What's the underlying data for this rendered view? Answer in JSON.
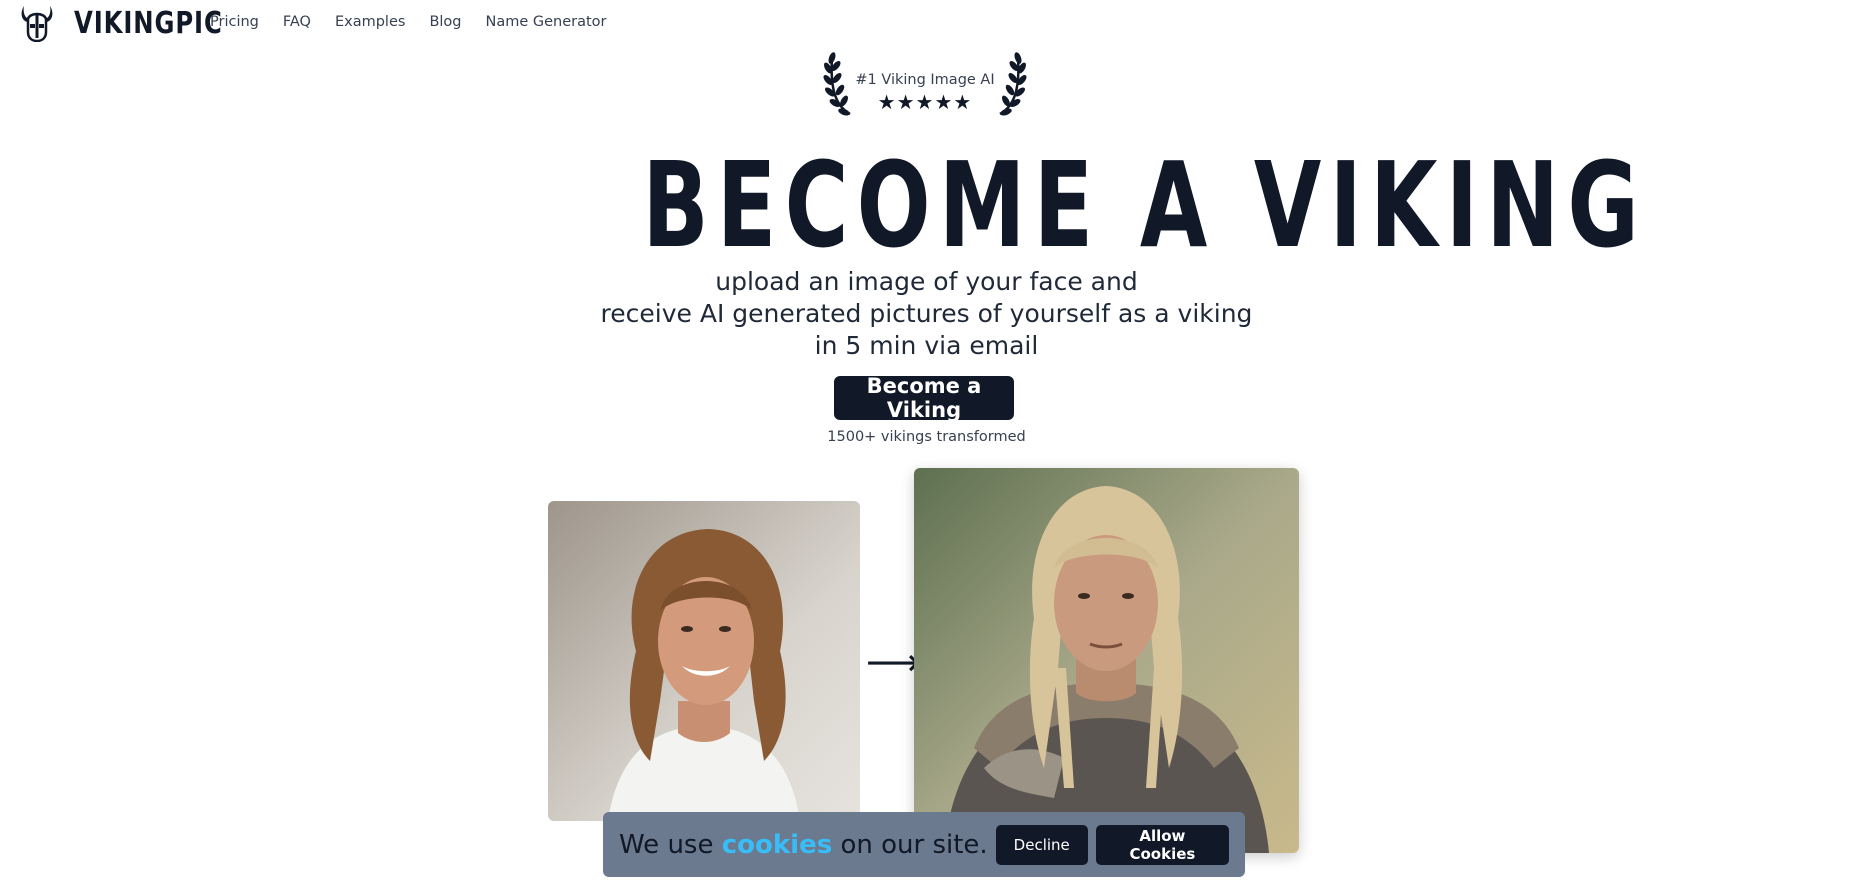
{
  "nav": {
    "logo_text": "VIKINGPIC",
    "links": [
      "Pricing",
      "FAQ",
      "Examples",
      "Blog",
      "Name Generator"
    ]
  },
  "badge": {
    "text": "#1 Viking Image AI",
    "stars": "★★★★★",
    "rating": 5
  },
  "hero": {
    "title": "BECOME A VIKING",
    "subtitle_lines": [
      "upload an image of your face and",
      "receive AI generated pictures of yourself as a viking",
      "in 5 min via email"
    ],
    "cta_label": "Become a Viking",
    "count_text": "1500+ vikings transformed"
  },
  "comparison": {
    "arrow": "⟶"
  },
  "cookie_banner": {
    "prefix": "We use",
    "highlight": "cookies",
    "suffix": "on our site.",
    "decline_label": "Decline",
    "allow_label": "Allow Cookies"
  },
  "colors": {
    "dark": "#111827",
    "cookie_bg": "#6b7a8f",
    "cookie_highlight": "#38bdf8"
  }
}
